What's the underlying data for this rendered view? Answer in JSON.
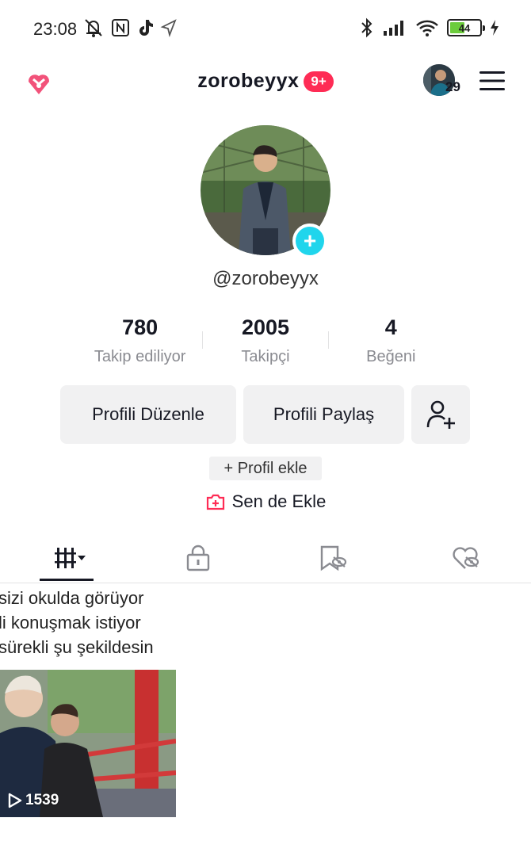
{
  "status_bar": {
    "time": "23:08",
    "battery_level": "44",
    "battery_color": "#6ccc3c",
    "icons": [
      "mute-bell-icon",
      "nfc-icon",
      "tiktok-icon",
      "location-icon",
      "bluetooth-icon",
      "signal-icon",
      "wifi-icon",
      "battery-icon",
      "charging-icon"
    ]
  },
  "header": {
    "username": "zorobeyyx",
    "notification_badge": "9+",
    "account_switch_count": "29",
    "accent_color": "#fe2c55"
  },
  "profile": {
    "handle": "@zorobeyyx",
    "add_avatar_symbol": "+",
    "stats": [
      {
        "value": "780",
        "label": "Takip ediliyor"
      },
      {
        "value": "2005",
        "label": "Takipçi"
      },
      {
        "value": "4",
        "label": "Beğeni"
      }
    ],
    "edit_button": "Profili Düzenle",
    "share_button": "Profili Paylaş",
    "add_profile_chip": "+ Profil ekle",
    "sen_de_ekle": "Sen de Ekle"
  },
  "tabs": [
    {
      "icon": "grid-icon",
      "active": true
    },
    {
      "icon": "lock-icon",
      "active": false
    },
    {
      "icon": "repost-hidden-icon",
      "active": false
    },
    {
      "icon": "liked-hidden-icon",
      "active": false
    }
  ],
  "videos": [
    {
      "caption_lines": [
        "sizi okulda görüyor",
        "li konuşmak istiyor",
        "sürekli şu şekildesin"
      ],
      "play_count": "1539"
    }
  ]
}
